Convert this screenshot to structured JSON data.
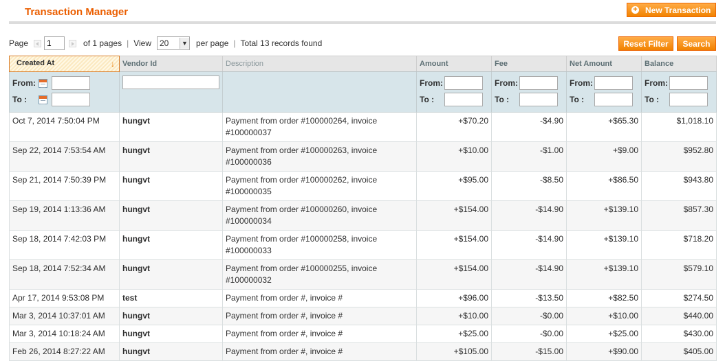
{
  "header": {
    "title": "Transaction Manager",
    "new_button": "New Transaction"
  },
  "pager": {
    "page_label": "Page",
    "page_value": "1",
    "of_pages": "of 1 pages",
    "view_label": "View",
    "view_value": "20",
    "per_page": "per page",
    "total": "Total 13 records found"
  },
  "actions": {
    "reset_filter": "Reset Filter",
    "search": "Search"
  },
  "columns": [
    "Created At",
    "Vendor Id",
    "Description",
    "Amount",
    "Fee",
    "Net Amount",
    "Balance"
  ],
  "filters": {
    "from": "From:",
    "to": "To :"
  },
  "rows": [
    {
      "created": "Oct 7, 2014 7:50:04 PM",
      "vendor": "hungvt",
      "description": "Payment from order #100000264, invoice #100000037",
      "amount": "+$70.20",
      "fee": "-$4.90",
      "net": "+$65.30",
      "balance": "$1,018.10"
    },
    {
      "created": "Sep 22, 2014 7:53:54 AM",
      "vendor": "hungvt",
      "description": "Payment from order #100000263, invoice #100000036",
      "amount": "+$10.00",
      "fee": "-$1.00",
      "net": "+$9.00",
      "balance": "$952.80"
    },
    {
      "created": "Sep 21, 2014 7:50:39 PM",
      "vendor": "hungvt",
      "description": "Payment from order #100000262, invoice #100000035",
      "amount": "+$95.00",
      "fee": "-$8.50",
      "net": "+$86.50",
      "balance": "$943.80"
    },
    {
      "created": "Sep 19, 2014 1:13:36 AM",
      "vendor": "hungvt",
      "description": "Payment from order #100000260, invoice #100000034",
      "amount": "+$154.00",
      "fee": "-$14.90",
      "net": "+$139.10",
      "balance": "$857.30"
    },
    {
      "created": "Sep 18, 2014 7:42:03 PM",
      "vendor": "hungvt",
      "description": "Payment from order #100000258, invoice #100000033",
      "amount": "+$154.00",
      "fee": "-$14.90",
      "net": "+$139.10",
      "balance": "$718.20"
    },
    {
      "created": "Sep 18, 2014 7:52:34 AM",
      "vendor": "hungvt",
      "description": "Payment from order #100000255, invoice #100000032",
      "amount": "+$154.00",
      "fee": "-$14.90",
      "net": "+$139.10",
      "balance": "$579.10"
    },
    {
      "created": "Apr 17, 2014 9:53:08 PM",
      "vendor": "test",
      "description": "Payment from order #, invoice #",
      "amount": "+$96.00",
      "fee": "-$13.50",
      "net": "+$82.50",
      "balance": "$274.50"
    },
    {
      "created": "Mar 3, 2014 10:37:01 AM",
      "vendor": "hungvt",
      "description": "Payment from order #, invoice #",
      "amount": "+$10.00",
      "fee": "-$0.00",
      "net": "+$10.00",
      "balance": "$440.00"
    },
    {
      "created": "Mar 3, 2014 10:18:24 AM",
      "vendor": "hungvt",
      "description": "Payment from order #, invoice #",
      "amount": "+$25.00",
      "fee": "-$0.00",
      "net": "+$25.00",
      "balance": "$430.00"
    },
    {
      "created": "Feb 26, 2014 8:27:22 AM",
      "vendor": "hungvt",
      "description": "Payment from order #, invoice #",
      "amount": "+$105.00",
      "fee": "-$15.00",
      "net": "+$90.00",
      "balance": "$405.00"
    }
  ],
  "colors": {
    "accent": "#eb5e00",
    "button": "#f18200",
    "filter_row": "#d7e5ea",
    "sorted_header_border": "#d97e2b"
  }
}
